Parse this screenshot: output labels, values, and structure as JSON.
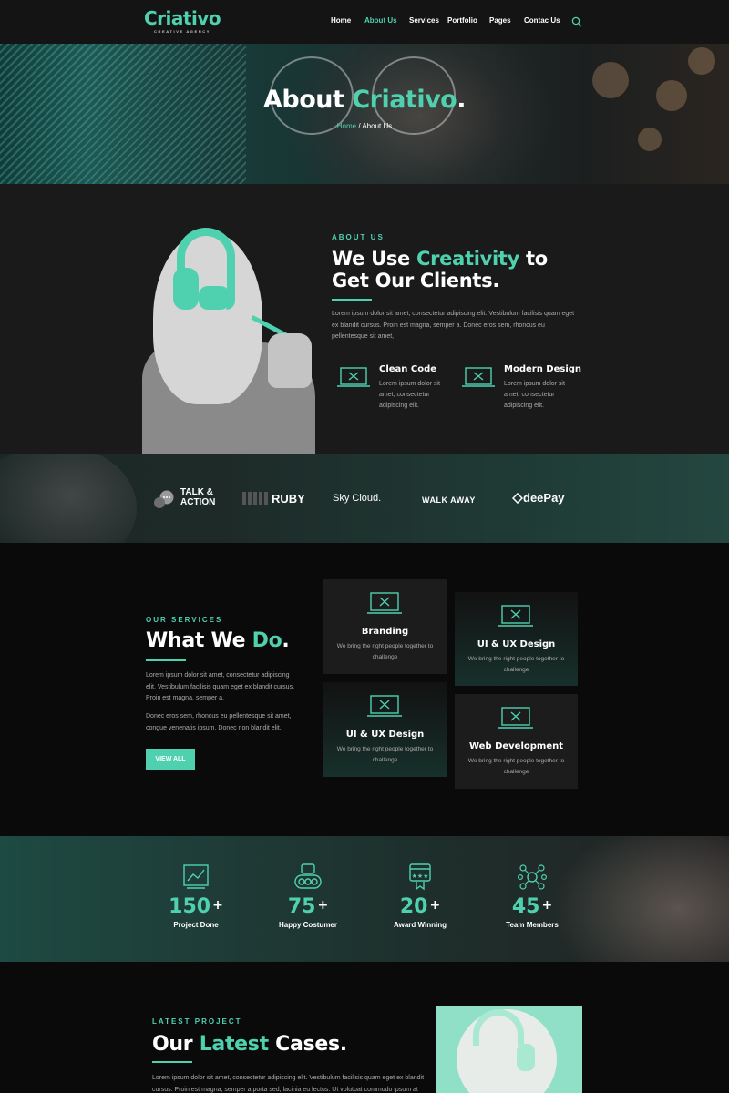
{
  "brand": {
    "name": "Criativo",
    "tagline": "CREATIVE AGENCY"
  },
  "colors": {
    "accent": "#4fd1b0",
    "background": "#121212",
    "card": "#1c1c1c"
  },
  "nav": {
    "items": [
      "Home",
      "About Us",
      "Services",
      "Portfolio",
      "Pages",
      "Contac Us"
    ],
    "active": "About Us",
    "search_icon": "search-icon"
  },
  "hero": {
    "title_plain": "About ",
    "title_accent": "Criativo",
    "title_dot": ".",
    "breadcrumb": {
      "home": "Home",
      "separator": " / ",
      "current": "About Us"
    }
  },
  "about": {
    "eyebrow": "ABOUT US",
    "title_line1_plain": "We Use ",
    "title_line1_accent": "Creativity",
    "title_line1_end": " to",
    "title_line2": "Get Our Clients.",
    "paragraph": "Lorem ipsum dolor sit amet, consectetur adipiscing elit. Vestibulum facilisis quam eget ex blandit cursus. Proin est magna, semper a. Donec eros sem, rhoncus eu pellentesque sit amet,",
    "features": [
      {
        "title": "Clean Code",
        "text": "Lorem ipsum dolor sit amet, consectetur adipiscing elit."
      },
      {
        "title": "Modern Design",
        "text": "Lorem ipsum dolor sit amet, consectetur adipiscing elit."
      }
    ]
  },
  "clients": [
    {
      "line1": "TALK &",
      "line2": "ACTION"
    },
    {
      "name": "RUBY"
    },
    {
      "name": "Sky Cloud."
    },
    {
      "name": "WALK AWAY"
    },
    {
      "name": "deePay"
    }
  ],
  "services": {
    "eyebrow": "OUR SERVICES",
    "title_plain": "What We ",
    "title_accent": "Do",
    "title_dot": ".",
    "paragraph1": "Lorem ipsum dolor sit amet, consectetur adipiscing elit. Vestibulum facilisis quam eget ex blandit cursus. Proin est magna, semper a.",
    "paragraph2": "Donec eros sem, rhoncus eu pellentesque sit amet, congue venenatis ipsum. Donec non blandit elit.",
    "button": "VIEW ALL",
    "cards": [
      {
        "title": "Branding",
        "text": "We bring the right people together to challenge"
      },
      {
        "title": "UI & UX Design",
        "text": "We bring the right people together to challenge"
      },
      {
        "title": "UI & UX Design",
        "text": "We bring the right people together to challenge"
      },
      {
        "title": "Web Development",
        "text": "We bring the right people together to challenge"
      }
    ]
  },
  "stats": [
    {
      "value": "150",
      "suffix": "+",
      "label": "Project Done",
      "icon": "chart-icon"
    },
    {
      "value": "75",
      "suffix": "+",
      "label": "Happy Costumer",
      "icon": "users-icon"
    },
    {
      "value": "20",
      "suffix": "+",
      "label": "Award Winning",
      "icon": "award-icon"
    },
    {
      "value": "45",
      "suffix": "+",
      "label": "Team Members",
      "icon": "team-network-icon"
    }
  ],
  "latest": {
    "eyebrow": "LATEST PROJECT",
    "title_plain": "Our ",
    "title_accent": "Latest",
    "title_end": " Cases.",
    "paragraph": "Lorem ipsum dolor sit amet, consectetur adipiscing elit. Vestibulum facilisis quam eget ex blandit cursus. Proin est magna, semper a porta sed, lacinia eu lectus. Ut volutpat commodo ipsum at"
  }
}
